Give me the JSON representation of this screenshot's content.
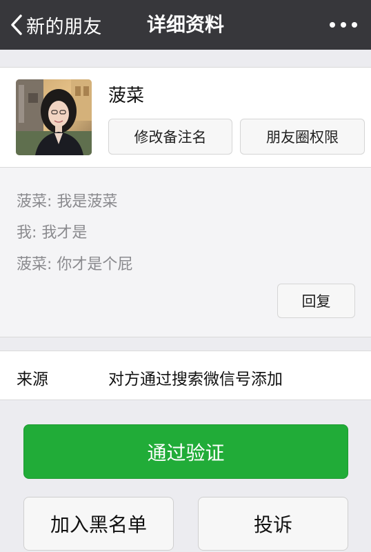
{
  "navbar": {
    "back_label": "新的朋友",
    "title": "详细资料",
    "more_icon": "more-dots-icon",
    "background": "#37373b"
  },
  "profile": {
    "name": "菠菜",
    "remark_button": "修改备注名",
    "moments_button": "朋友圈权限"
  },
  "messages": [
    "菠菜: 我是菠菜",
    "我: 我才是",
    "菠菜: 你才是个屁"
  ],
  "reply_button": "回复",
  "source": {
    "label": "来源",
    "value": "对方通过搜索微信号添加"
  },
  "actions": {
    "accept": "通过验证",
    "accept_color": "#21ac38",
    "block": "加入黑名单",
    "report": "投诉"
  }
}
